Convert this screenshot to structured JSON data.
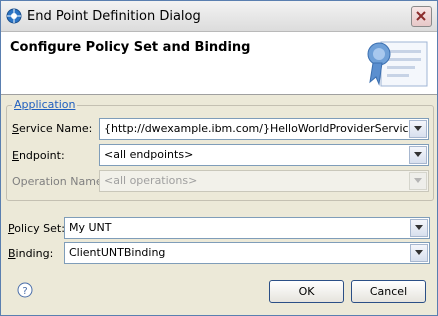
{
  "window": {
    "title": "End Point Definition Dialog"
  },
  "banner": {
    "heading": "Configure Policy Set and Binding"
  },
  "application": {
    "group_label": "Application",
    "service_name": {
      "label_key": "S",
      "label_rest": "ervice Name:",
      "value": "{http://dwexample.ibm.com/}HelloWorldProviderService"
    },
    "endpoint": {
      "label_key": "E",
      "label_rest": "ndpoint:",
      "value": "<all endpoints>"
    },
    "operation_name": {
      "label": "Operation Name:",
      "value": "<all operations>"
    }
  },
  "policy_set": {
    "label_key": "P",
    "label_rest": "olicy Set:",
    "value": "My UNT"
  },
  "binding": {
    "label_key": "B",
    "label_rest": "inding:",
    "value": "ClientUNTBinding"
  },
  "buttons": {
    "ok": "OK",
    "cancel": "Cancel"
  },
  "icons": {
    "app": "app-icon",
    "close": "close-icon",
    "help": "help-icon",
    "certificate": "certificate-icon"
  }
}
